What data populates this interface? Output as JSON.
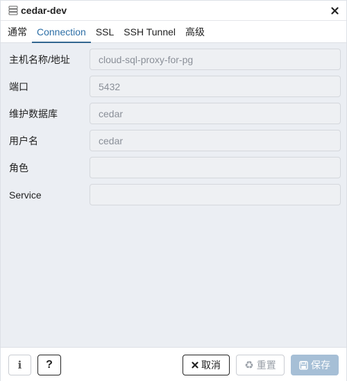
{
  "window": {
    "title": "cedar-dev",
    "icon": "server-icon",
    "close_icon": "close-icon"
  },
  "tabs": [
    {
      "label": "通常",
      "active": false
    },
    {
      "label": "Connection",
      "active": true
    },
    {
      "label": "SSL",
      "active": false
    },
    {
      "label": "SSH Tunnel",
      "active": false
    },
    {
      "label": "高级",
      "active": false
    }
  ],
  "form": {
    "host": {
      "label": "主机名称/地址",
      "value": "cloud-sql-proxy-for-pg"
    },
    "port": {
      "label": "端口",
      "value": "5432"
    },
    "maintenance_db": {
      "label": "维护数据库",
      "value": "cedar"
    },
    "username": {
      "label": "用户名",
      "value": "cedar"
    },
    "role": {
      "label": "角色",
      "value": ""
    },
    "service": {
      "label": "Service",
      "value": ""
    }
  },
  "footer": {
    "info_label": "i",
    "help_label": "?",
    "cancel_label": "取消",
    "reset_label": "重置",
    "save_label": "保存"
  },
  "colors": {
    "accent": "#2c6ea6",
    "body_bg": "#ebeef3",
    "save_disabled": "#a6bfd6"
  }
}
